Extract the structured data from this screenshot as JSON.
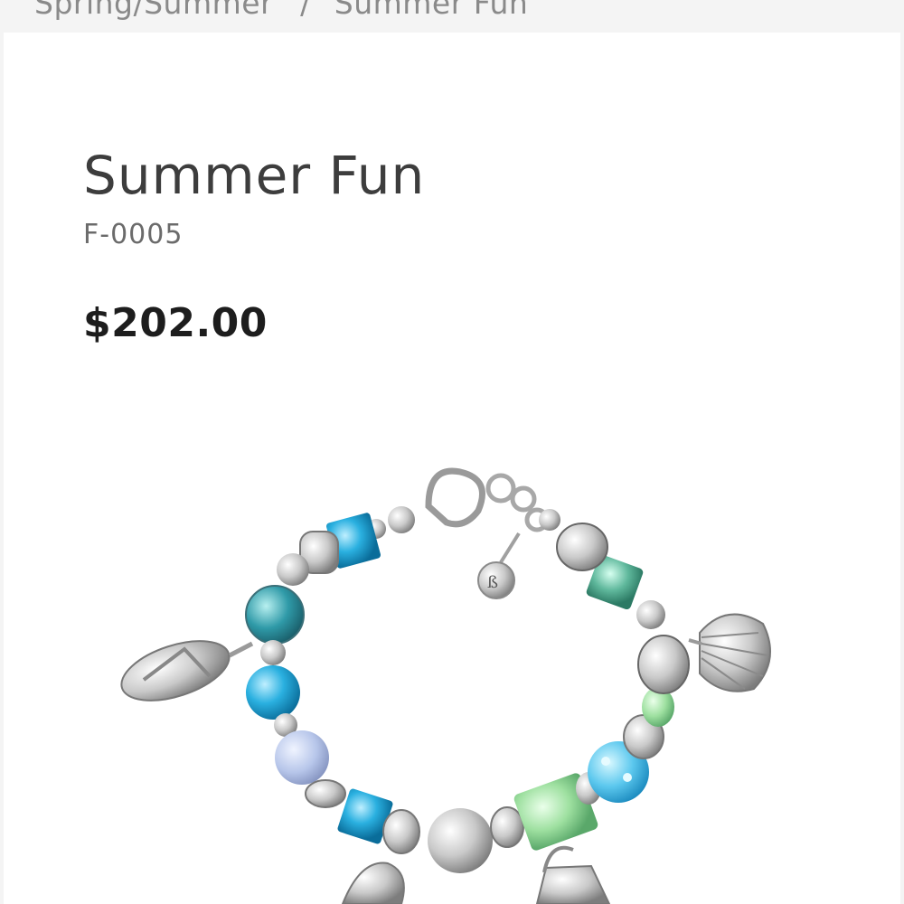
{
  "breadcrumb": {
    "items": [
      "Spring/Summer",
      "Summer Fun"
    ],
    "separator": "/"
  },
  "product": {
    "title": "Summer Fun",
    "sku": "F-0005",
    "price": "$202.00",
    "image_icon": "charm-bracelet-image"
  },
  "colors": {
    "background": "#f4f4f4",
    "card": "#ffffff",
    "title": "#3d3d3d",
    "price": "#1d1d1d",
    "breadcrumb": "#8a8a8a"
  }
}
